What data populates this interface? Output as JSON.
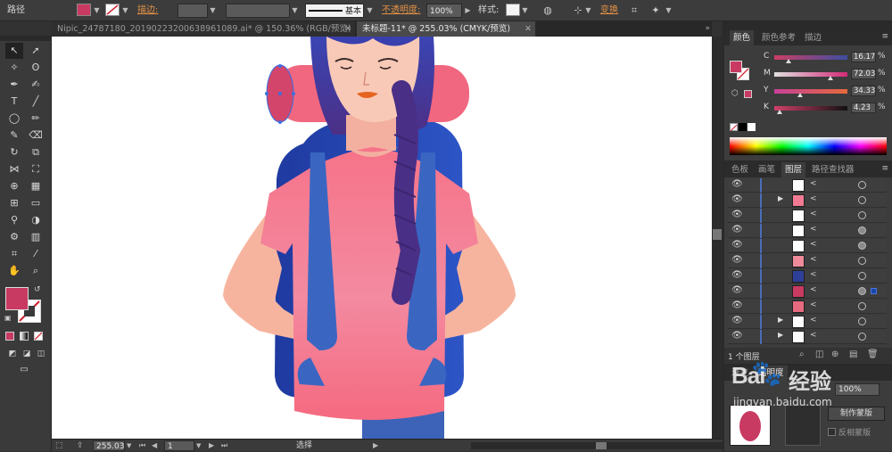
{
  "control_bar": {
    "object_type": "路径",
    "fill_color": "#c83a62",
    "stroke_label": "描边:",
    "stroke_style_label": "基本",
    "opacity_label": "不透明度:",
    "opacity_value": "100%",
    "style_label": "样式:",
    "transform_label": "变换"
  },
  "doc_tabs": [
    {
      "label": "Nipic_24787180_20190223200638961089.ai* @ 150.36% (RGB/预览)",
      "active": false
    },
    {
      "label": "未标题-11* @ 255.03% (CMYK/预览)",
      "active": true
    }
  ],
  "tools": {
    "fill_swatch_color": "#c83a62"
  },
  "status_bar": {
    "zoom": "255.03",
    "artboard": "1",
    "tool_name": "选择"
  },
  "color_panel": {
    "tabs": [
      "颜色",
      "颜色参考",
      "描边"
    ],
    "channels": [
      {
        "letter": "C",
        "value": "16.17",
        "fraction": 0.16
      },
      {
        "letter": "M",
        "value": "72.03",
        "fraction": 0.72
      },
      {
        "letter": "Y",
        "value": "34.33",
        "fraction": 0.34
      },
      {
        "letter": "K",
        "value": "4.23",
        "fraction": 0.04
      }
    ],
    "pct": "%",
    "current_color": "#c83a62"
  },
  "layers_panel": {
    "tabs": [
      "色板",
      "画笔",
      "图层",
      "路径查找器"
    ],
    "layer_name_prefix": "<",
    "layers_count": "1 个图层",
    "rows": [
      {
        "thumb": "#ffffff",
        "expand": false,
        "target_filled": false,
        "selected": false
      },
      {
        "thumb": "#f27b93",
        "expand": true,
        "target_filled": false,
        "selected": false
      },
      {
        "thumb": "#ffffff",
        "expand": false,
        "target_filled": false,
        "selected": false
      },
      {
        "thumb": "#ffffff",
        "expand": false,
        "target_filled": true,
        "selected": false
      },
      {
        "thumb": "#ffffff",
        "expand": false,
        "target_filled": true,
        "selected": false
      },
      {
        "thumb": "#ee8a9a",
        "expand": false,
        "target_filled": false,
        "selected": false
      },
      {
        "thumb": "#2e3f9a",
        "expand": false,
        "target_filled": false,
        "selected": false
      },
      {
        "thumb": "#c83a62",
        "expand": false,
        "target_filled": false,
        "selected": true
      },
      {
        "thumb": "#e86a80",
        "expand": false,
        "target_filled": false,
        "selected": false
      },
      {
        "thumb": "#ffffff",
        "expand": true,
        "target_filled": false,
        "selected": false
      },
      {
        "thumb": "#ffffff",
        "expand": true,
        "target_filled": false,
        "selected": false
      }
    ]
  },
  "transparency_panel": {
    "tab_label": "渐变",
    "tab_label_2": "透明度",
    "opacity": "100%",
    "make_mask": "制作蒙版",
    "invert_mask": "反相蒙版"
  },
  "watermark": {
    "text_1": "Bai",
    "text_2": "经验",
    "url": "jingyan.baidu.com"
  }
}
